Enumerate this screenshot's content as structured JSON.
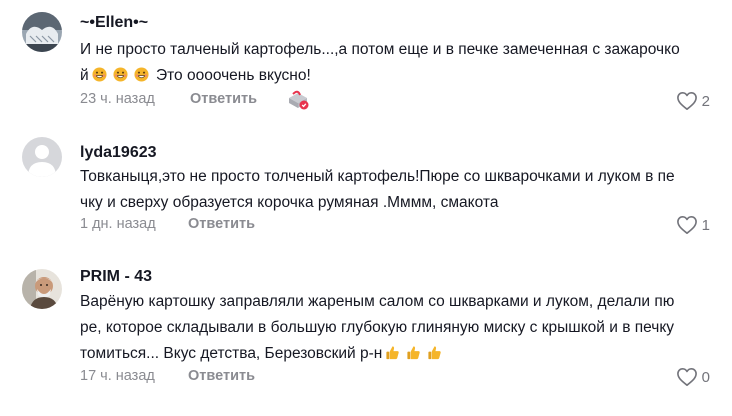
{
  "comments": [
    {
      "username": "~•Ellen•~",
      "text_lines": [
        "И не просто талченый картофель...,а потом еще и в печке замеченная с зажарочко",
        "й",
        " Это оооочень вкусно!"
      ],
      "emojis": [
        "grinning-face-emoji",
        "grinning-face-emoji",
        "grinning-face-emoji"
      ],
      "time": "23 ч. назад",
      "reply_label": "Ответить",
      "like_count": "2",
      "has_gift_badge": true
    },
    {
      "username": "lyda19623",
      "text_lines": [
        "Товканыця,это не просто толченый картофель!Пюре со шкварочками и луком в пе",
        "чку и сверху образуется корочка румяная .Мммм, смакота"
      ],
      "time": "1 дн. назад",
      "reply_label": "Ответить",
      "like_count": "1"
    },
    {
      "username": "PRIM - 43",
      "text_lines": [
        "Варёную картошку заправляли жареным салом со шкварками и луком, делали пю",
        "ре, которое складывали в большую глубокую глиняную миску с крышкой и в печку",
        "томиться... Вкус детства, Березовский р-н"
      ],
      "emojis": [
        "thumbs-up-emoji",
        "thumbs-up-emoji",
        "thumbs-up-emoji"
      ],
      "time": "17 ч. назад",
      "reply_label": "Ответить",
      "like_count": "0"
    }
  ],
  "colors": {
    "text": "#161823",
    "meta": "#8a8b91",
    "like_icon": "#73747b",
    "emoji_yellow": "#f5b52a",
    "badge_red": "#e8344e"
  }
}
